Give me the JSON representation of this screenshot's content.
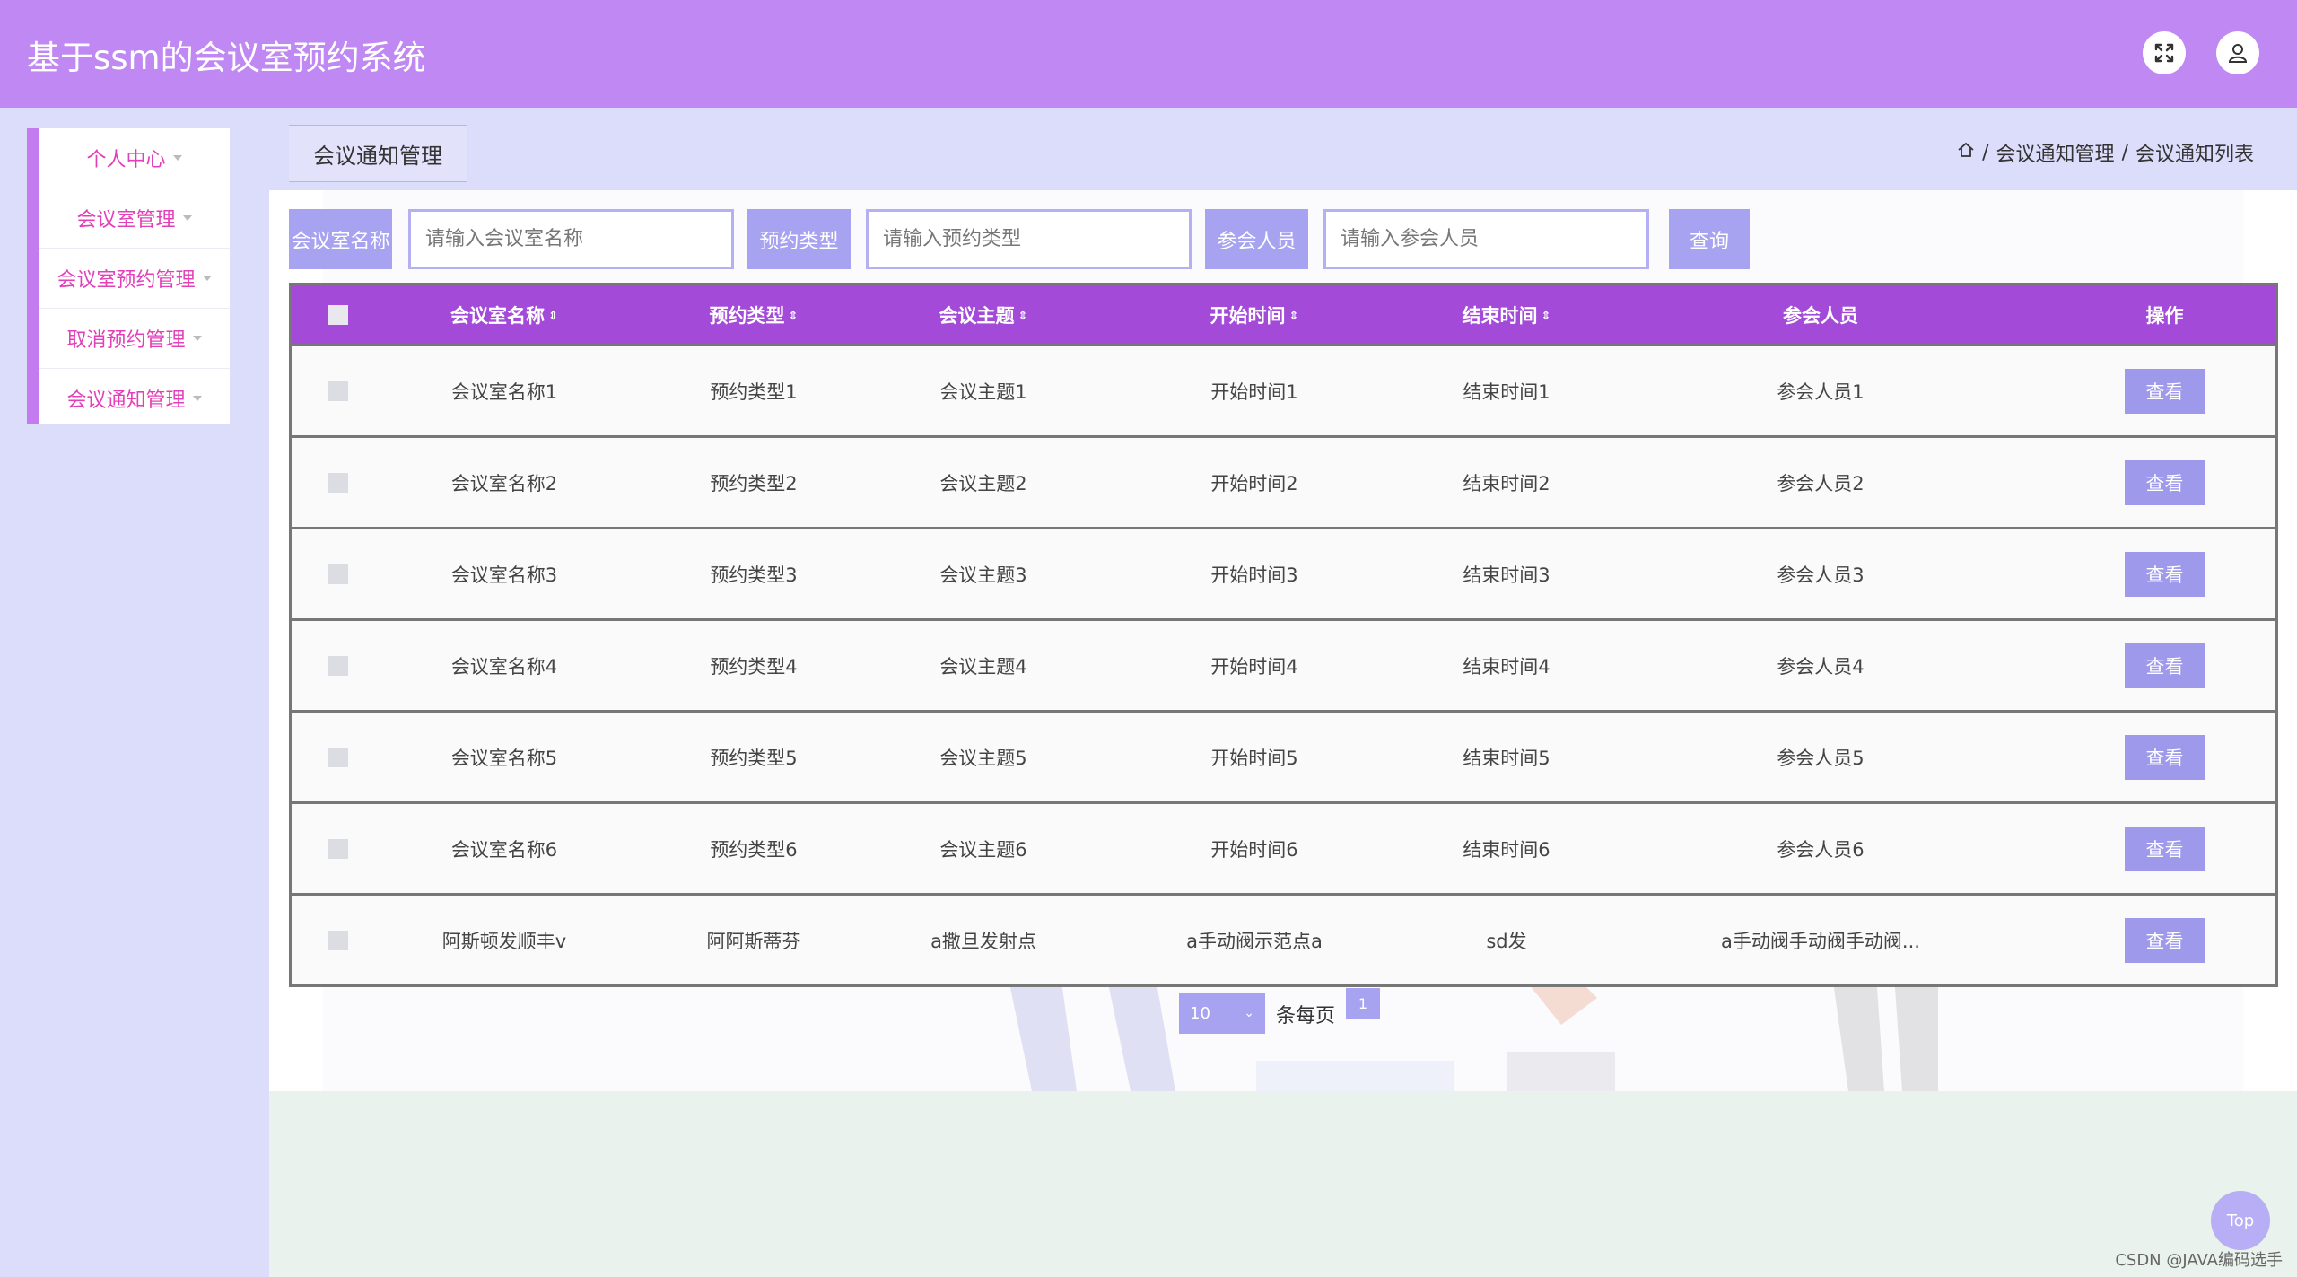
{
  "header": {
    "title": "基于ssm的会议室预约系统",
    "fullscreen_icon": "fullscreen-icon",
    "user_icon": "user-icon"
  },
  "sidebar": {
    "items": [
      {
        "label": "个人中心"
      },
      {
        "label": "会议室管理"
      },
      {
        "label": "会议室预约管理"
      },
      {
        "label": "取消预约管理"
      },
      {
        "label": "会议通知管理"
      }
    ]
  },
  "page_tab": "会议通知管理",
  "breadcrumb": {
    "home_icon": "home-icon",
    "separator": "/",
    "level1": "会议通知管理",
    "level2": "会议通知列表"
  },
  "search": {
    "room_label": "会议室名称",
    "room_placeholder": "请输入会议室名称",
    "type_label": "预约类型",
    "type_placeholder": "请输入预约类型",
    "attendee_label": "参会人员",
    "attendee_placeholder": "请输入参会人员",
    "query_button": "查询"
  },
  "table": {
    "headers": [
      "会议室名称",
      "预约类型",
      "会议主题",
      "开始时间",
      "结束时间",
      "参会人员",
      "操作"
    ],
    "sort_glyph": "⇕",
    "action_label": "查看",
    "rows": [
      [
        "会议室名称1",
        "预约类型1",
        "会议主题1",
        "开始时间1",
        "结束时间1",
        "参会人员1"
      ],
      [
        "会议室名称2",
        "预约类型2",
        "会议主题2",
        "开始时间2",
        "结束时间2",
        "参会人员2"
      ],
      [
        "会议室名称3",
        "预约类型3",
        "会议主题3",
        "开始时间3",
        "结束时间3",
        "参会人员3"
      ],
      [
        "会议室名称4",
        "预约类型4",
        "会议主题4",
        "开始时间4",
        "结束时间4",
        "参会人员4"
      ],
      [
        "会议室名称5",
        "预约类型5",
        "会议主题5",
        "开始时间5",
        "结束时间5",
        "参会人员5"
      ],
      [
        "会议室名称6",
        "预约类型6",
        "会议主题6",
        "开始时间6",
        "结束时间6",
        "参会人员6"
      ],
      [
        "阿斯顿发顺丰v",
        "阿阿斯蒂芬",
        "a撒旦发射点",
        "a手动阀示范点a",
        "sd发",
        "a手动阀手动阀手动阀..."
      ]
    ]
  },
  "pagination": {
    "page_size": "10",
    "per_page_label": "条每页",
    "current_page": "1"
  },
  "back_to_top": "Top",
  "watermark": "CSDN @JAVA编码选手",
  "colors": {
    "header": "#bf88f2",
    "accent": "#a8a3f0",
    "table_header": "#a44ad9",
    "sidebar_text": "#e23fb8"
  }
}
